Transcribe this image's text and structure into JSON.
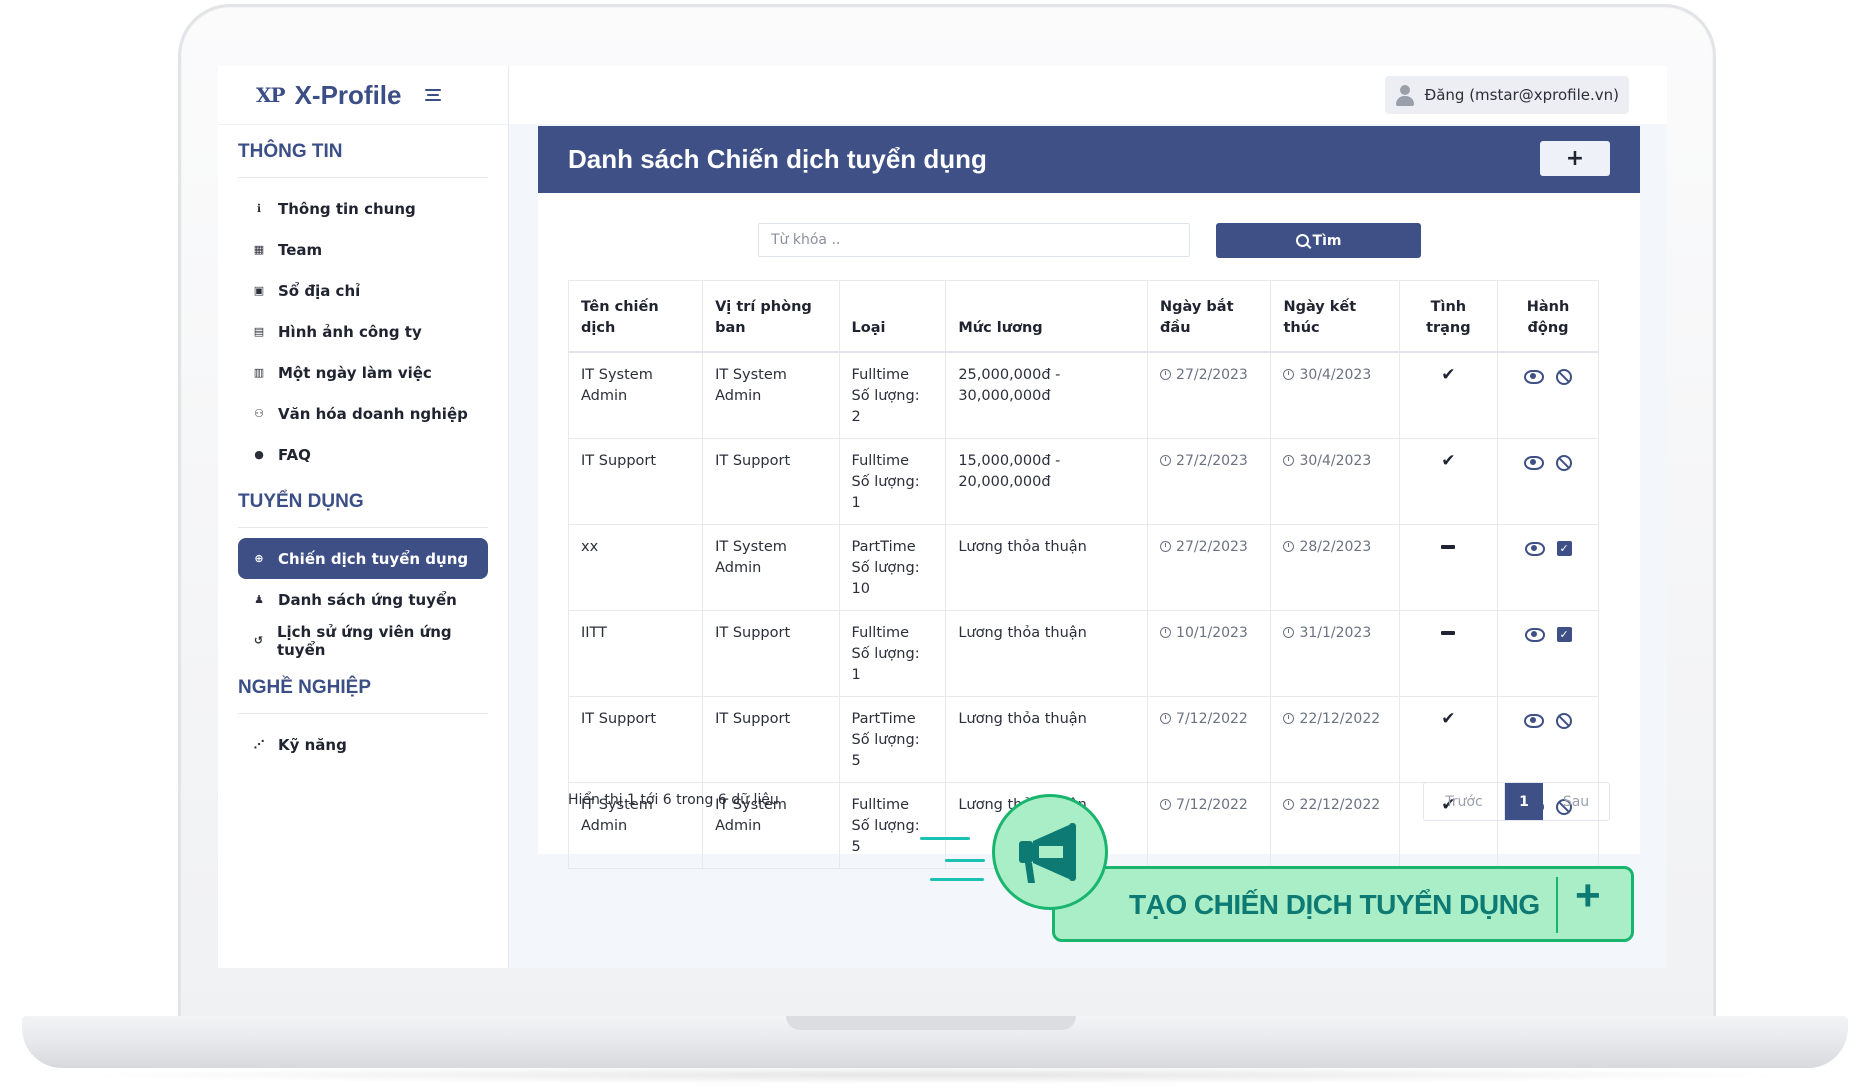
{
  "brand": {
    "mark": "XP",
    "name": "X-Profile"
  },
  "user": {
    "label": "Đăng (mstar@xprofile.vn)"
  },
  "sidebar": {
    "sections": [
      {
        "title": "THÔNG TIN",
        "items": [
          {
            "label": "Thông tin chung",
            "icon": "info-icon"
          },
          {
            "label": "Team",
            "icon": "building-icon"
          },
          {
            "label": "Sổ địa chỉ",
            "icon": "address-book-icon"
          },
          {
            "label": "Hình ảnh công ty",
            "icon": "image-file-icon"
          },
          {
            "label": "Một ngày làm việc",
            "icon": "film-icon"
          },
          {
            "label": "Văn hóa doanh nghiệp",
            "icon": "handshake-icon"
          },
          {
            "label": "FAQ",
            "icon": "comment-icon"
          }
        ]
      },
      {
        "title": "TUYỂN DỤNG",
        "items": [
          {
            "label": "Chiến dịch tuyển dụng",
            "icon": "search-plus-icon",
            "active": true
          },
          {
            "label": "Danh sách ứng tuyển",
            "icon": "users-icon"
          },
          {
            "label": "Lịch sử ứng viên ứng tuyển",
            "icon": "history-icon"
          }
        ]
      },
      {
        "title": "NGHỀ NGHIỆP",
        "items": [
          {
            "label": "Kỹ năng",
            "icon": "share-nodes-icon"
          }
        ]
      }
    ]
  },
  "main": {
    "title": "Danh sách Chiến dịch tuyển dụng",
    "add_label": "+",
    "search": {
      "placeholder": "Từ khóa ..",
      "value": "",
      "button_label": "Tìm"
    },
    "table": {
      "columns": [
        "Tên chiến dịch",
        "Vị trí phòng ban",
        "Loại",
        "Mức lương",
        "Ngày bắt đầu",
        "Ngày kết thúc",
        "Tình trạng",
        "Hành động"
      ],
      "rows": [
        {
          "name": "IT System Admin",
          "position": "IT System Admin",
          "type": "Fulltime",
          "quantity": "Số lượng: 2",
          "salary": "25,000,000đ - 30,000,000đ",
          "start": "27/2/2023",
          "end": "30/4/2023",
          "status": "active",
          "action": "disable"
        },
        {
          "name": "IT Support",
          "position": "IT Support",
          "type": "Fulltime",
          "quantity": "Số lượng: 1",
          "salary": "15,000,000đ - 20,000,000đ",
          "start": "27/2/2023",
          "end": "30/4/2023",
          "status": "active",
          "action": "disable"
        },
        {
          "name": "xx",
          "position": "IT System Admin",
          "type": "PartTime",
          "quantity": "Số lượng: 10",
          "salary": "Lương thỏa thuận",
          "start": "27/2/2023",
          "end": "28/2/2023",
          "status": "inactive",
          "action": "enable"
        },
        {
          "name": "IITT",
          "position": "IT Support",
          "type": "Fulltime",
          "quantity": "Số lượng: 1",
          "salary": "Lương thỏa thuận",
          "start": "10/1/2023",
          "end": "31/1/2023",
          "status": "inactive",
          "action": "enable"
        },
        {
          "name": "IT Support",
          "position": "IT Support",
          "type": "PartTime",
          "quantity": "Số lượng: 5",
          "salary": "Lương thỏa thuận",
          "start": "7/12/2022",
          "end": "22/12/2022",
          "status": "active",
          "action": "disable"
        },
        {
          "name": "IT System Admin",
          "position": "IT System Admin",
          "type": "Fulltime",
          "quantity": "Số lượng: 5",
          "salary": "Lương thỏa thuận",
          "start": "7/12/2022",
          "end": "22/12/2022",
          "status": "active",
          "action": "disable"
        }
      ]
    },
    "footer_info": "Hiển thị 1 tới 6 trong 6 dữ liệu",
    "pagination": {
      "prev": "Trước",
      "current": "1",
      "next": "Sau"
    }
  },
  "promo": {
    "text": "TẠO CHIẾN DỊCH TUYỂN DỤNG",
    "plus": "+",
    "icon": "megaphone-icon"
  },
  "colors": {
    "primary": "#3e5085",
    "promo_fill": "#a9eec6",
    "promo_border": "#19b56e",
    "promo_text": "#0e7a74"
  }
}
